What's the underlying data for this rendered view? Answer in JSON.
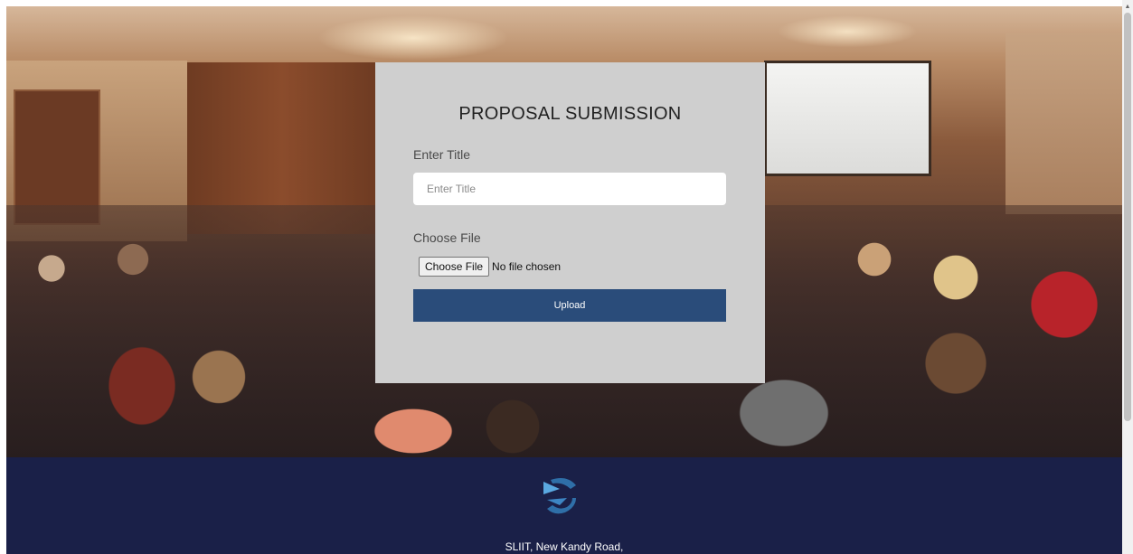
{
  "card": {
    "title": "PROPOSAL SUBMISSION",
    "title_label": "Enter Title",
    "title_placeholder": "Enter Title",
    "file_label": "Choose File",
    "file_button": "Choose File",
    "file_status": "No file chosen",
    "upload_label": "Upload"
  },
  "footer": {
    "address": "SLIIT, New Kandy Road,",
    "logo_icon": "sliit-logo-icon"
  },
  "colors": {
    "card_bg": "#cfcfcf",
    "upload_bg": "#2a4c7a",
    "footer_bg": "#1a2048"
  }
}
